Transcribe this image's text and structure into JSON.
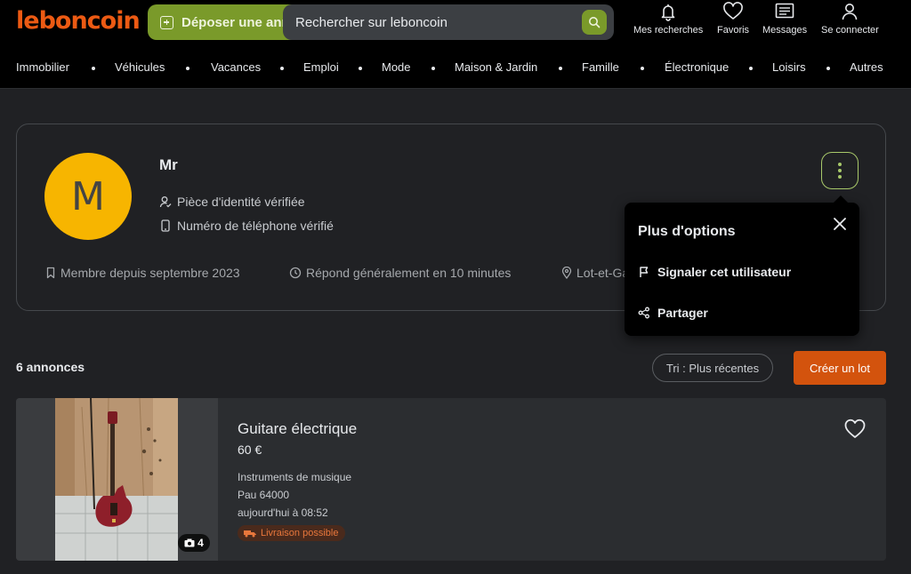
{
  "header": {
    "logo": "leboncoin",
    "post_label": "Déposer une annonce",
    "search_placeholder": "Rechercher sur leboncoin",
    "nav": [
      {
        "label": "Mes recherches",
        "icon": "bell-icon"
      },
      {
        "label": "Favoris",
        "icon": "heart-icon"
      },
      {
        "label": "Messages",
        "icon": "message-icon"
      },
      {
        "label": "Se connecter",
        "icon": "user-icon"
      }
    ]
  },
  "categories": [
    "Immobilier",
    "Véhicules",
    "Vacances",
    "Emploi",
    "Mode",
    "Maison & Jardin",
    "Famille",
    "Électronique",
    "Loisirs",
    "Autres"
  ],
  "profile": {
    "avatar_letter": "M",
    "name": "Mr",
    "id_verified": "Pièce d'identité vérifiée",
    "phone_verified": "Numéro de téléphone vérifié",
    "member_since": "Membre depuis septembre 2023",
    "response_time": "Répond généralement en 10 minutes",
    "location": "Lot-et-Garonne"
  },
  "popover": {
    "title": "Plus d'options",
    "report": "Signaler cet utilisateur",
    "share": "Partager"
  },
  "listing": {
    "count": "6 annonces",
    "sort_label": "Tri : Plus récentes",
    "create_lot": "Créer un lot"
  },
  "ad": {
    "title": "Guitare électrique",
    "price": "60 €",
    "category": "Instruments de musique",
    "location": "Pau 64000",
    "date": "aujourd'hui à 08:52",
    "delivery": "Livraison possible",
    "photo_count": "4"
  },
  "colors": {
    "brand": "#ec5a13",
    "accent_green": "#7a9a2a",
    "cta_orange": "#d3530d",
    "avatar_yellow": "#f7b500"
  }
}
